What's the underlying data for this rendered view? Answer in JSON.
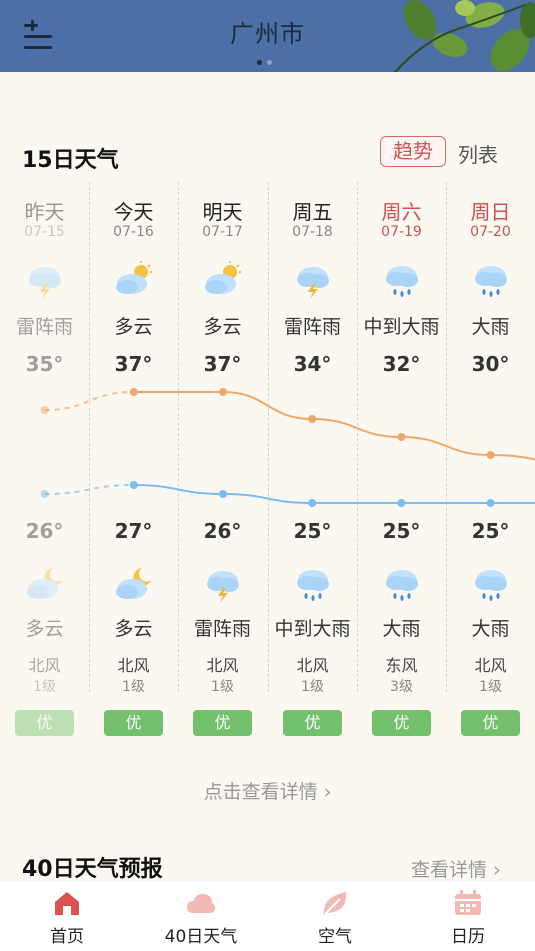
{
  "header": {
    "city": "广州市",
    "menu_icon": "menu-list-icon",
    "page_dots": 2,
    "active_dot": 0
  },
  "forecast15": {
    "title": "15日天气",
    "tab_trend": "趋势",
    "tab_list": "列表",
    "days": [
      {
        "day": "昨天",
        "date": "07-15",
        "day_weather": "雷阵雨",
        "day_icon": "thunderstorm-icon",
        "high": "35°",
        "low": "26°",
        "night_weather": "多云",
        "night_icon": "cloudy-night-icon",
        "wind": "北风",
        "wind_level": "1级",
        "aqi": "优",
        "past": true,
        "weekend": false
      },
      {
        "day": "今天",
        "date": "07-16",
        "day_weather": "多云",
        "day_icon": "partly-cloudy-icon",
        "high": "37°",
        "low": "27°",
        "night_weather": "多云",
        "night_icon": "cloudy-night-icon",
        "wind": "北风",
        "wind_level": "1级",
        "aqi": "优",
        "past": false,
        "weekend": false
      },
      {
        "day": "明天",
        "date": "07-17",
        "day_weather": "多云",
        "day_icon": "partly-cloudy-icon",
        "high": "37°",
        "low": "26°",
        "night_weather": "雷阵雨",
        "night_icon": "thunderstorm-icon",
        "wind": "北风",
        "wind_level": "1级",
        "aqi": "优",
        "past": false,
        "weekend": false
      },
      {
        "day": "周五",
        "date": "07-18",
        "day_weather": "雷阵雨",
        "day_icon": "thunderstorm-icon",
        "high": "34°",
        "low": "25°",
        "night_weather": "中到大雨",
        "night_icon": "rain-icon",
        "wind": "北风",
        "wind_level": "1级",
        "aqi": "优",
        "past": false,
        "weekend": false
      },
      {
        "day": "周六",
        "date": "07-19",
        "day_weather": "中到大雨",
        "day_icon": "rain-icon",
        "high": "32°",
        "low": "25°",
        "night_weather": "大雨",
        "night_icon": "rain-icon",
        "wind": "东风",
        "wind_level": "3级",
        "aqi": "优",
        "past": false,
        "weekend": true
      },
      {
        "day": "周日",
        "date": "07-20",
        "day_weather": "大雨",
        "day_icon": "rain-icon",
        "high": "30°",
        "low": "25°",
        "night_weather": "大雨",
        "night_icon": "rain-icon",
        "wind": "北风",
        "wind_level": "1级",
        "aqi": "优",
        "past": false,
        "weekend": true
      }
    ],
    "high_values": [
      35,
      37,
      37,
      34,
      32,
      30,
      29
    ],
    "low_values": [
      26,
      27,
      26,
      25,
      25,
      25,
      25
    ],
    "more_link": "点击查看详情"
  },
  "forecast40": {
    "title": "40日天气预报",
    "more": "查看详情"
  },
  "nav": {
    "items": [
      {
        "label": "首页",
        "icon": "home-icon",
        "active": true
      },
      {
        "label": "40日天气",
        "icon": "cloud-icon",
        "active": false
      },
      {
        "label": "空气",
        "icon": "leaf-icon",
        "active": false
      },
      {
        "label": "日历",
        "icon": "calendar-icon",
        "active": false
      }
    ]
  },
  "colors": {
    "header_bg": "#4b6fa6",
    "accent_red": "#d05353",
    "high_line": "#f0a766",
    "low_line": "#7bbdf0",
    "aqi_good": "#73c16c",
    "nav_active": "#d9534f",
    "nav_inactive": "#f2b9b4"
  }
}
